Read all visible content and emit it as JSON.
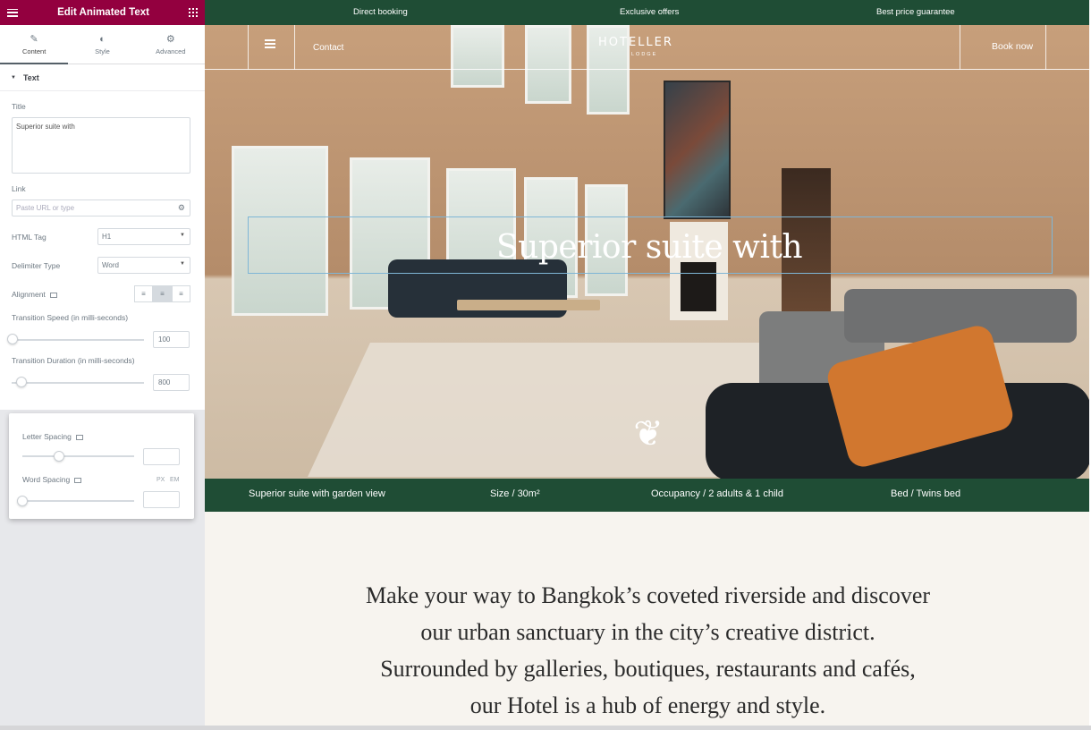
{
  "panel": {
    "header_title": "Edit Animated Text",
    "tabs": [
      {
        "label": "Content",
        "icon": "pencil-icon"
      },
      {
        "label": "Style",
        "icon": "half-circle-icon"
      },
      {
        "label": "Advanced",
        "icon": "gear-icon"
      }
    ],
    "section_title": "Text",
    "title_label": "Title",
    "title_value": "Superior suite with",
    "link_label": "Link",
    "link_placeholder": "Paste URL or type",
    "html_tag_label": "HTML Tag",
    "html_tag_value": "H1",
    "delimiter_label": "Delimiter Type",
    "delimiter_value": "Word",
    "alignment_label": "Alignment",
    "speed_label": "Transition Speed (in milli-seconds)",
    "speed_value": "100",
    "duration_label": "Transition Duration (in milli-seconds)",
    "duration_value": "800",
    "letter_spacing_label": "Letter Spacing",
    "word_spacing_label": "Word Spacing",
    "units": [
      "PX",
      "EM"
    ]
  },
  "site": {
    "topbar": [
      "Direct booking",
      "Exclusive offers",
      "Best price guarantee"
    ],
    "nav_contact": "Contact",
    "logo": "HOTELLER",
    "logo_sub": "LODGE",
    "book_now": "Book now",
    "hero_title": "Superior suite with",
    "info": [
      "Superior suite with garden view",
      "Size / 30m²",
      "Occupancy / 2 adults & 1 child",
      "Bed / Twins bed"
    ],
    "paragraph": [
      "Make your way to Bangkok’s coveted riverside and discover",
      "our urban sanctuary in the city’s creative district.",
      "Surrounded by galleries, boutiques, restaurants and cafés,",
      "our Hotel is a hub of energy and style."
    ]
  },
  "colors": {
    "editor_accent": "#93003f",
    "site_green": "#1f4d35",
    "selection_outline": "#7fb6d6"
  }
}
